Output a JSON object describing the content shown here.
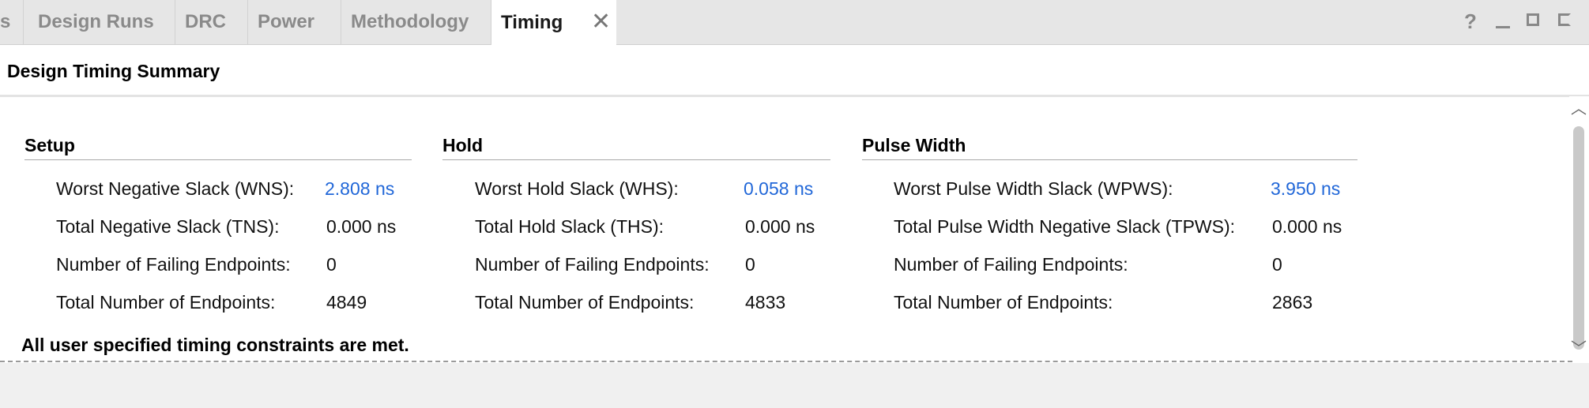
{
  "tabs": [
    {
      "label": "s",
      "active": false
    },
    {
      "label": "Design Runs",
      "active": false
    },
    {
      "label": "DRC",
      "active": false
    },
    {
      "label": "Power",
      "active": false
    },
    {
      "label": "Methodology",
      "active": false
    },
    {
      "label": "Timing",
      "active": true
    }
  ],
  "window_controls": {
    "help": "?"
  },
  "panel_title": "Design Timing Summary",
  "setup": {
    "heading": "Setup",
    "rows": [
      {
        "label": "Worst Negative Slack (WNS):",
        "value": "2.808 ns"
      },
      {
        "label": "Total Negative Slack (TNS):",
        "value": "0.000 ns"
      },
      {
        "label": "Number of Failing Endpoints:",
        "value": "0"
      },
      {
        "label": "Total Number of Endpoints:",
        "value": "4849"
      }
    ]
  },
  "hold": {
    "heading": "Hold",
    "rows": [
      {
        "label": "Worst Hold Slack (WHS):",
        "value": "0.058 ns"
      },
      {
        "label": "Total Hold Slack (THS):",
        "value": "0.000 ns"
      },
      {
        "label": "Number of Failing Endpoints:",
        "value": "0"
      },
      {
        "label": "Total Number of Endpoints:",
        "value": "4833"
      }
    ]
  },
  "pulse_width": {
    "heading": "Pulse Width",
    "rows": [
      {
        "label": "Worst Pulse Width Slack (WPWS):",
        "value": "3.950 ns"
      },
      {
        "label": "Total Pulse Width Negative Slack (TPWS):",
        "value": "0.000 ns"
      },
      {
        "label": "Number of Failing Endpoints:",
        "value": "0"
      },
      {
        "label": "Total Number of Endpoints:",
        "value": "2863"
      }
    ]
  },
  "status_message": "All user specified timing constraints are met.",
  "colors": {
    "link": "#2167d8"
  }
}
